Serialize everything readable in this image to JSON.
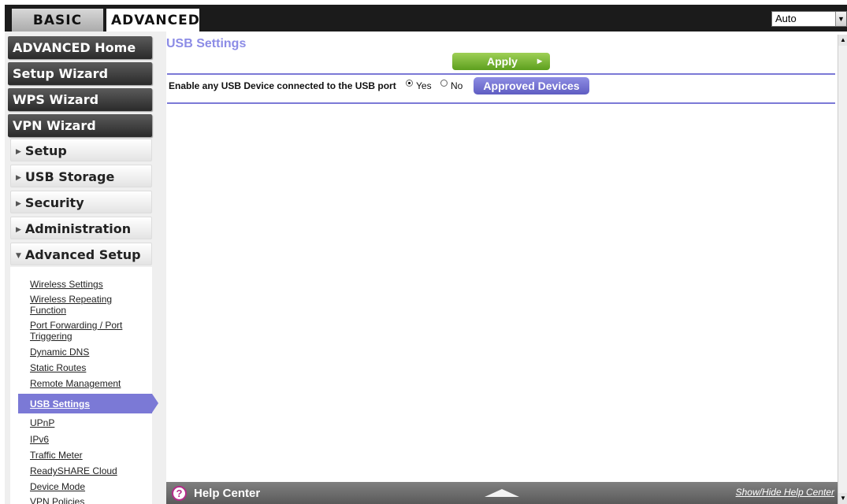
{
  "tabs": {
    "basic": "BASIC",
    "advanced": "ADVANCED"
  },
  "language": {
    "selected": "Auto"
  },
  "sidebar": {
    "main_items": [
      "ADVANCED Home",
      "Setup Wizard",
      "WPS Wizard",
      "VPN Wizard"
    ],
    "sections": [
      "Setup",
      "USB Storage",
      "Security",
      "Administration",
      "Advanced Setup"
    ],
    "sub_items": {
      "wireless_settings": "Wireless Settings",
      "wireless_repeating_1": "Wireless Repeating",
      "wireless_repeating_2": "Function",
      "port_forwarding_1": "Port Forwarding / Port",
      "port_forwarding_2": "Triggering",
      "dynamic_dns": "Dynamic DNS",
      "static_routes": "Static Routes",
      "remote_management": "Remote Management",
      "usb_settings": "USB Settings",
      "upnp": "UPnP",
      "ipv6": "IPv6",
      "traffic_meter": "Traffic Meter",
      "readyshare_cloud": "ReadySHARE Cloud",
      "device_mode": "Device Mode",
      "vpn_policies": "VPN Policies"
    }
  },
  "main": {
    "title": "USB Settings",
    "apply_label": "Apply",
    "enable_label": "Enable any USB Device connected to the USB port",
    "yes_label": "Yes",
    "no_label": "No",
    "enable_value": "Yes",
    "approved_devices_label": "Approved Devices"
  },
  "help": {
    "title": "Help Center",
    "toggle_link": "Show/Hide Help Center"
  }
}
